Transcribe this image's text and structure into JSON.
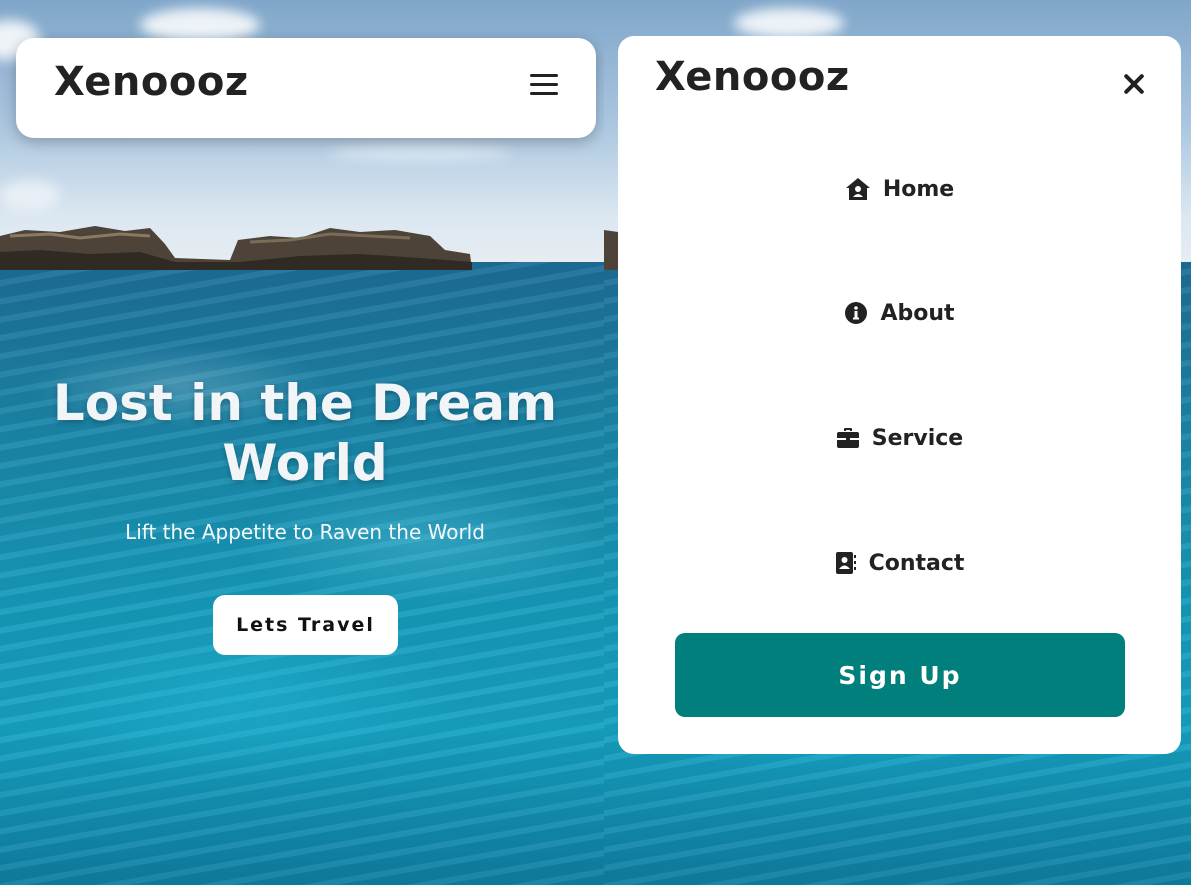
{
  "left_screen": {
    "navbar": {
      "brand": "Xenoooz",
      "menu_icon": "hamburger-menu-icon"
    },
    "hero": {
      "title": "Lost in the Dream World",
      "subtitle": "Lift the Appetite to Raven the World",
      "cta_label": "Lets Travel"
    }
  },
  "right_screen": {
    "menu": {
      "brand": "Xenoooz",
      "close_icon": "close-icon",
      "items": [
        {
          "label": "Home",
          "icon": "home-icon"
        },
        {
          "label": "About",
          "icon": "info-icon"
        },
        {
          "label": "Service",
          "icon": "briefcase-icon"
        },
        {
          "label": "Contact",
          "icon": "contact-book-icon"
        }
      ],
      "signup_label": "Sign Up"
    }
  },
  "colors": {
    "accent": "#007f7c",
    "card_background": "#ffffff",
    "text_dark": "#222222"
  }
}
